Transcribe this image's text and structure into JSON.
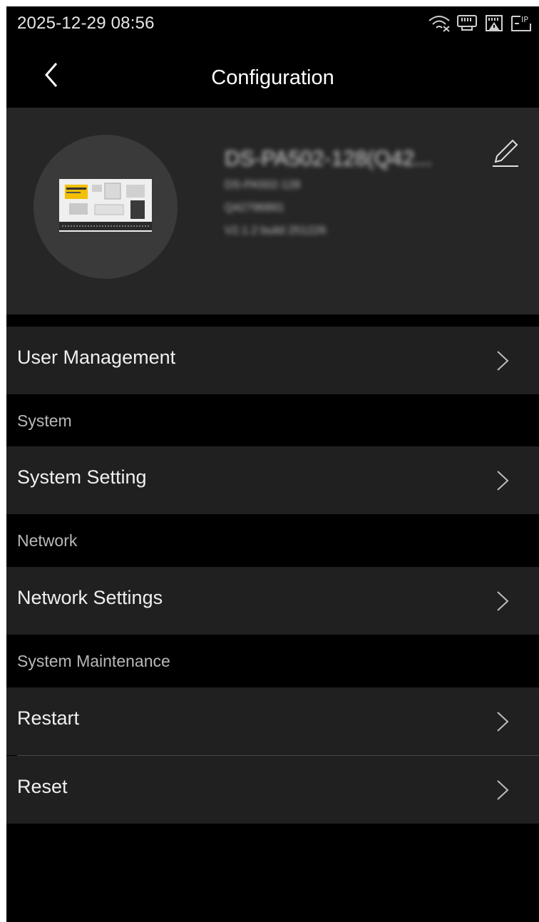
{
  "status_bar": {
    "datetime": "2025-12-29 08:56",
    "icons": [
      "wifi-disconnected-icon",
      "ethernet-icon",
      "sim-warning-icon",
      "ip-icon"
    ]
  },
  "header": {
    "title": "Configuration",
    "back_icon": "back-arrow-icon"
  },
  "device": {
    "name": "DS-PA502-128(Q42...",
    "model": "DS-PA502-128",
    "serial": "Q42796891",
    "firmware": "V2.1.2 build 251226",
    "edit_icon": "pencil-icon"
  },
  "menu": {
    "user_management": "User Management",
    "system_section": "System",
    "system_setting": "System Setting",
    "network_section": "Network",
    "network_settings": "Network Settings",
    "maintenance_section": "System Maintenance",
    "restart": "Restart",
    "reset": "Reset"
  },
  "colors": {
    "background": "#000000",
    "row": "#202020",
    "card": "#262626",
    "avatar": "#3a3a3a"
  }
}
